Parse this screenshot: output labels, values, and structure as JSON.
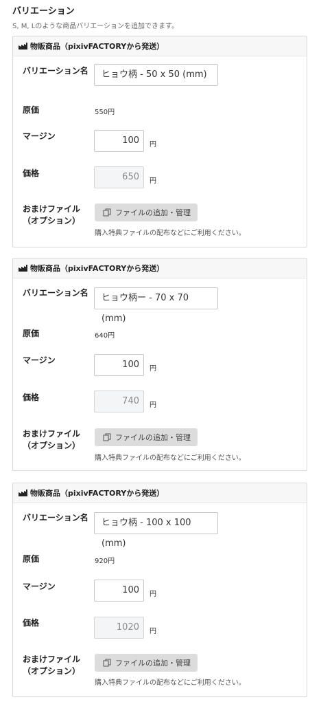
{
  "section": {
    "title": "バリエーション",
    "description": "S, M, Lのような商品バリエーションを追加できます。"
  },
  "labels": {
    "card_header": "物販商品（pixivFACTORYから発送）",
    "variation_name": "バリエーション名",
    "cost": "原価",
    "margin": "マージン",
    "price": "価格",
    "bonus_file": "おまけファイル（オプション）",
    "yen": "円",
    "file_button": "ファイルの追加・管理",
    "file_hint": "購入特典ファイルの配布などにご利用ください。"
  },
  "icons": {
    "header_icon": "factory-icon",
    "file_button_icon": "copy-file-icon"
  },
  "variations": [
    {
      "name": "ヒョウ柄 - 50 x 50 (mm)",
      "cost": "550円",
      "margin": "100",
      "price": "650"
    },
    {
      "name": "ヒョウ柄ー - 70 x 70 (mm)",
      "cost": "640円",
      "margin": "100",
      "price": "740"
    },
    {
      "name": "ヒョウ柄 - 100 x 100 (mm)",
      "cost": "920円",
      "margin": "100",
      "price": "1020"
    }
  ]
}
